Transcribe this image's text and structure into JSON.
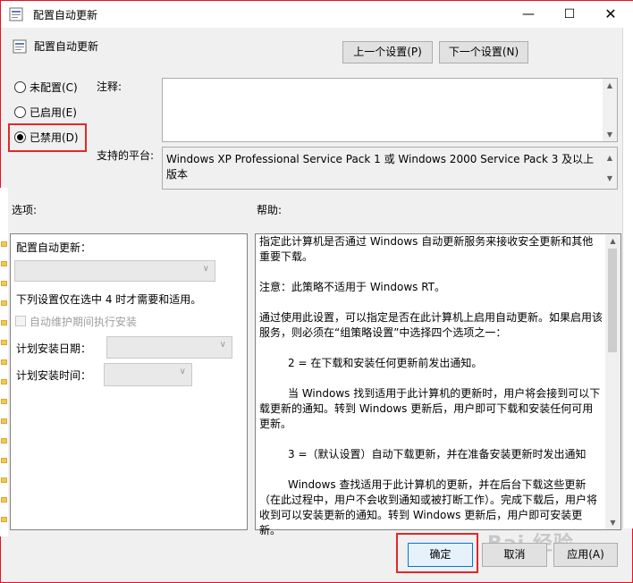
{
  "window": {
    "title": "配置自动更新",
    "caption_buttons": {
      "minimize": "—",
      "maximize": "☐",
      "close": "✕"
    }
  },
  "header": {
    "title": "配置自动更新"
  },
  "nav": {
    "prev_label": "上一个设置(P)",
    "next_label": "下一个设置(N)"
  },
  "radios": [
    {
      "label": "未配置(C)",
      "selected": false
    },
    {
      "label": "已启用(E)",
      "selected": false
    },
    {
      "label": "已禁用(D)",
      "selected": true
    }
  ],
  "comment": {
    "label": "注释:",
    "value": ""
  },
  "platform": {
    "label": "支持的平台:",
    "value": "Windows XP Professional Service Pack 1 或 Windows 2000 Service Pack 3 及以上版本"
  },
  "options": {
    "label": "选项:",
    "configure_label": "配置自动更新：",
    "note": "下列设置仅在选中 4 时才需要和适用。",
    "maintenance_checkbox": "自动维护期间执行安装",
    "schedule_day_label": "计划安装日期：",
    "schedule_time_label": "计划安装时间："
  },
  "help": {
    "label": "帮助:",
    "paragraphs": [
      "指定此计算机是否通过 Windows 自动更新服务来接收安全更新和其他重要下载。",
      "注意：此策略不适用于 Windows RT。",
      "通过使用此设置，可以指定是否在此计算机上启用自动更新。如果启用该服务，则必须在“组策略设置”中选择四个选项之一：",
      "2 = 在下载和安装任何更新前发出通知。",
      "当 Windows 找到适用于此计算机的更新时，用户将会接到可以下载更新的通知。转到 Windows 更新后，用户即可下载和安装任何可用更新。",
      "3 =（默认设置）自动下载更新，并在准备安装更新时发出通知",
      "Windows 查找适用于此计算机的更新，并在后台下载这些更新（在此过程中，用户不会收到通知或被打断工作）。完成下载后，用户将收到可以安装更新的通知。转到 Windows 更新后，用户即可安装更新。"
    ]
  },
  "footer": {
    "ok_label": "确定",
    "cancel_label": "取消",
    "apply_label": "应用(A)"
  },
  "watermark": "Bai 经验",
  "colors": {
    "highlight_red": "#e0282a",
    "accent_blue": "#0078d7"
  }
}
